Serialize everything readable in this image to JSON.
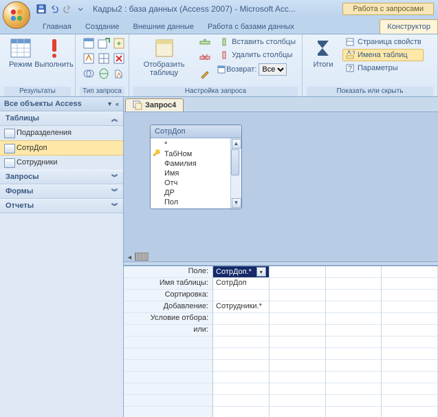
{
  "title": "Кадры2 : база данных (Access 2007) - Microsoft Acc...",
  "contextTab": "Работа с запросами",
  "tabs": {
    "home": "Главная",
    "create": "Создание",
    "external": "Внешние данные",
    "dbtools": "Работа с базами данных",
    "design": "Конструктор"
  },
  "ribbon": {
    "results": {
      "mode": "Режим",
      "run": "Выполнить",
      "label": "Результаты"
    },
    "querytype": {
      "label": "Тип запроса"
    },
    "querysetup": {
      "showtable": "Отобразить таблицу",
      "insertcols": "Вставить столбцы",
      "deletecols": "Удалить столбцы",
      "returns": "Возврат:",
      "returnsVal": "Все",
      "label": "Настройка запроса"
    },
    "totals": "Итоги",
    "showhide": {
      "propsheet": "Страница свойств",
      "tablenames": "Имена таблиц",
      "params": "Параметры",
      "label": "Показать или скрыть"
    }
  },
  "nav": {
    "header": "Все объекты Access",
    "tables": "Таблицы",
    "items": {
      "t0": "Подразделения",
      "t1": "СотрДоп",
      "t2": "Сотрудники"
    },
    "queries": "Запросы",
    "forms": "Формы",
    "reports": "Отчеты"
  },
  "docTab": "Запрос4",
  "tablebox": {
    "title": "СотрДоп",
    "star": "*",
    "f0": "ТабНом",
    "f1": "Фамилия",
    "f2": "Имя",
    "f3": "Отч",
    "f4": "ДР",
    "f5": "Пол"
  },
  "grid": {
    "labels": {
      "field": "Поле:",
      "table": "Имя таблицы:",
      "sort": "Сортировка:",
      "append": "Добавление:",
      "criteria": "Условие отбора:",
      "or": "или:"
    },
    "col0": {
      "field": "СотрДоп.*",
      "table": "СотрДоп",
      "append": "Сотрудники.*"
    }
  }
}
